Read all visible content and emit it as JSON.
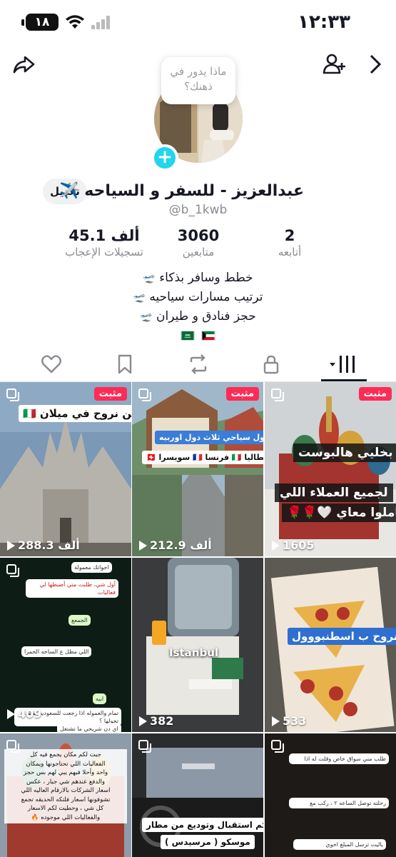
{
  "status_bar": {
    "time": "١٢:٣٣",
    "battery": "١٨"
  },
  "bubble": {
    "text": "ماذا يدور في ذهنك؟"
  },
  "profile": {
    "display_name": "عبدالعزيز - للسفر و السياحه ✈️",
    "username": "@b_1kwb",
    "edit_label": "تعديل"
  },
  "stats": [
    {
      "value": "2",
      "label": "أتابعه"
    },
    {
      "value": "3060",
      "label": "متابعين"
    },
    {
      "value": "45.1 ألف",
      "label": "تسجيلات الإعجاب"
    }
  ],
  "bio": {
    "line1": "خطط وسافر بذكاء",
    "line2": "ترتيب مسارات سياحيه",
    "line3": "حجز فنادق و طيران"
  },
  "tabs": [
    "videos-grid",
    "lock",
    "repost",
    "bookmark",
    "heart"
  ],
  "videos": [
    {
      "pinned": "مثبت",
      "views": "1605",
      "caption1": "بخليي هالبوست",
      "caption2": "لجميع العملاء اللي",
      "caption3": "تعاملوا معاي 🤍🌹🌹"
    },
    {
      "pinned": "مثبت",
      "views": "212.9 ألف",
      "caption1": "جدول سياحي ثلاث دول اوربيه",
      "caption2": "ايطاليا 🇮🇹 فرنسا 🇫🇷 سويسرا 🇨🇭"
    },
    {
      "pinned": "مثبت",
      "views": "288.3 ألف",
      "caption1": "وين نروح في ميلان 🇮🇹"
    },
    {
      "views": "533",
      "caption1": "وين نروح ب اسطنبووول"
    },
    {
      "views": "382",
      "caption1": "Istanbul"
    },
    {
      "views": "409",
      "chat": [
        "اجواتك معمولة",
        "أول شي، طلبت مني أضبطها لي فعاليات",
        "الجمعع",
        "اللي مطل ع الساحه الحمرا",
        "ابيه",
        "تمام والعموله اذا رجعت للسعوديه تقصد تحولها ؟",
        "اي دن شريحي ما تشتغل"
      ]
    },
    {
      "caption_lines": [
        "طلب مني سواق خاص وقلت له اذا",
        "رحلته توصل الساعه ٢ ، ركب مع",
        "ياليت ترسل المبلغ اخوي"
      ]
    },
    {
      "caption1": "نوفر لكم استقبال وتوديع من مطار",
      "caption2": "موسكو ( مرسيدس )"
    },
    {
      "caption_lines": [
        "جبت لكم مكان يجمع فيه كل",
        "الفعاليات اللي تحتاجونها ويمكان",
        "واحد وأحلا فيهم يبي لهم بس حجز",
        "والدفع عندهم شي جبار ، عكس",
        "اسعار الشركات بالارقام العاليه اللي",
        "تشوفونها اسعار فلتكه الحديقه تجمع",
        "كل شي ، وحطيت لكم الاسعار",
        "والفعاليات اللي موجوده 🔥"
      ]
    }
  ],
  "colors": {
    "accent": "#fe2c55",
    "plus": "#20d5ec"
  }
}
